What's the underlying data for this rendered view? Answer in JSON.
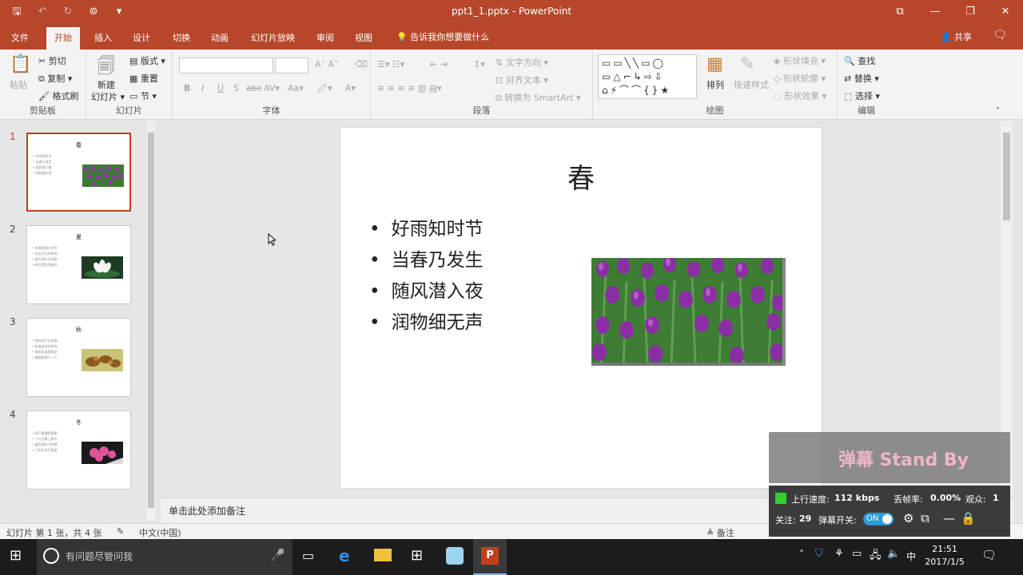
{
  "window": {
    "title": "ppt1_1.pptx  -  PowerPoint",
    "controls": [
      "⧉",
      "—",
      "❐",
      "✕"
    ]
  },
  "tabs": [
    {
      "label": "文件"
    },
    {
      "label": "开始"
    },
    {
      "label": "插入"
    },
    {
      "label": "设计"
    },
    {
      "label": "切换"
    },
    {
      "label": "动画"
    },
    {
      "label": "幻灯片放映"
    },
    {
      "label": "审阅"
    },
    {
      "label": "视图"
    }
  ],
  "tell_me": "告诉我你想要做什么",
  "share": "共享",
  "ribbon": {
    "clipboard": {
      "label": "剪贴板",
      "paste": "粘贴",
      "cut": "剪切",
      "copy": "复制",
      "format_painter": "格式刷"
    },
    "slides": {
      "label": "幻灯片",
      "new_slide": "新建",
      "new_slide2": "幻灯片",
      "layout": "版式",
      "reset": "重置",
      "section": "节"
    },
    "font": {
      "label": "字体",
      "bold": "B",
      "italic": "I",
      "underline": "U",
      "shadow": "S",
      "strike": "abc",
      "spacing": "AV",
      "case": "Aa",
      "grow": "A",
      "shrink": "A"
    },
    "paragraph": {
      "label": "段落",
      "text_direction": "文字方向",
      "align_text": "对齐文本",
      "smartart": "转换为 SmartArt"
    },
    "drawing": {
      "label": "绘图",
      "arrange": "排列",
      "quick_styles": "快速样式",
      "shape_fill": "形状填充",
      "shape_outline": "形状轮廓",
      "shape_effects": "形状效果",
      "shapes": "▭▭╲╲▭◯ ▭△⌐↳⇨⇩ ⌂⚡⌒⌒{}★"
    },
    "editing": {
      "label": "编辑",
      "find": "查找",
      "replace": "替换",
      "select": "选择"
    }
  },
  "thumbnails": [
    {
      "num": "1",
      "title": "春",
      "lines": [
        "• 好雨知时节",
        "• 当春乃发生",
        "• 随风潜入夜",
        "• 润物细无声"
      ]
    },
    {
      "num": "2",
      "title": "夏",
      "lines": [
        "• 毕竟西湖六月中",
        "• 风光不与四时同",
        "• 接天莲叶无穷碧",
        "• 映日荷花别样红"
      ]
    },
    {
      "num": "3",
      "title": "秋",
      "lines": [
        "• 独在异乡为异客",
        "• 每逢佳节倍思亲",
        "• 遥知兄弟登高处",
        "• 遍插茱萸少一人"
      ]
    },
    {
      "num": "4",
      "title": "冬",
      "lines": [
        "• 雨只黄鹂鸣翠柳",
        "• 一行白鹭上青天",
        "• 窗含西岭千秋雪",
        "• 门泊东吴万里船"
      ]
    }
  ],
  "slide": {
    "title": "春",
    "bullets": [
      "好雨知时节",
      "当春乃发生",
      "随风潜入夜",
      "润物细无声"
    ]
  },
  "notes_placeholder": "单击此处添加备注",
  "status": {
    "slide_info": "幻灯片 第 1 张，共 4 张",
    "language": "中文(中国)",
    "notes": "备注"
  },
  "danmaku": {
    "title": "弹幕 Stand By",
    "upload_label": "上行速度:",
    "upload_value": "112 kbps",
    "loss_label": "丢帧率:",
    "loss_value": "0.00%",
    "viewers_label": "观众:",
    "viewers_value": "1",
    "follow_label": "关注:",
    "follow_value": "29",
    "switch_label": "弹幕开关:",
    "switch_state": "ON"
  },
  "taskbar": {
    "search_placeholder": "有问题尽管问我",
    "time": "21:51",
    "date": "2017/1/5",
    "ime": "中"
  },
  "colors": {
    "accent": "#b7472a",
    "selected": "#c43e1c"
  }
}
